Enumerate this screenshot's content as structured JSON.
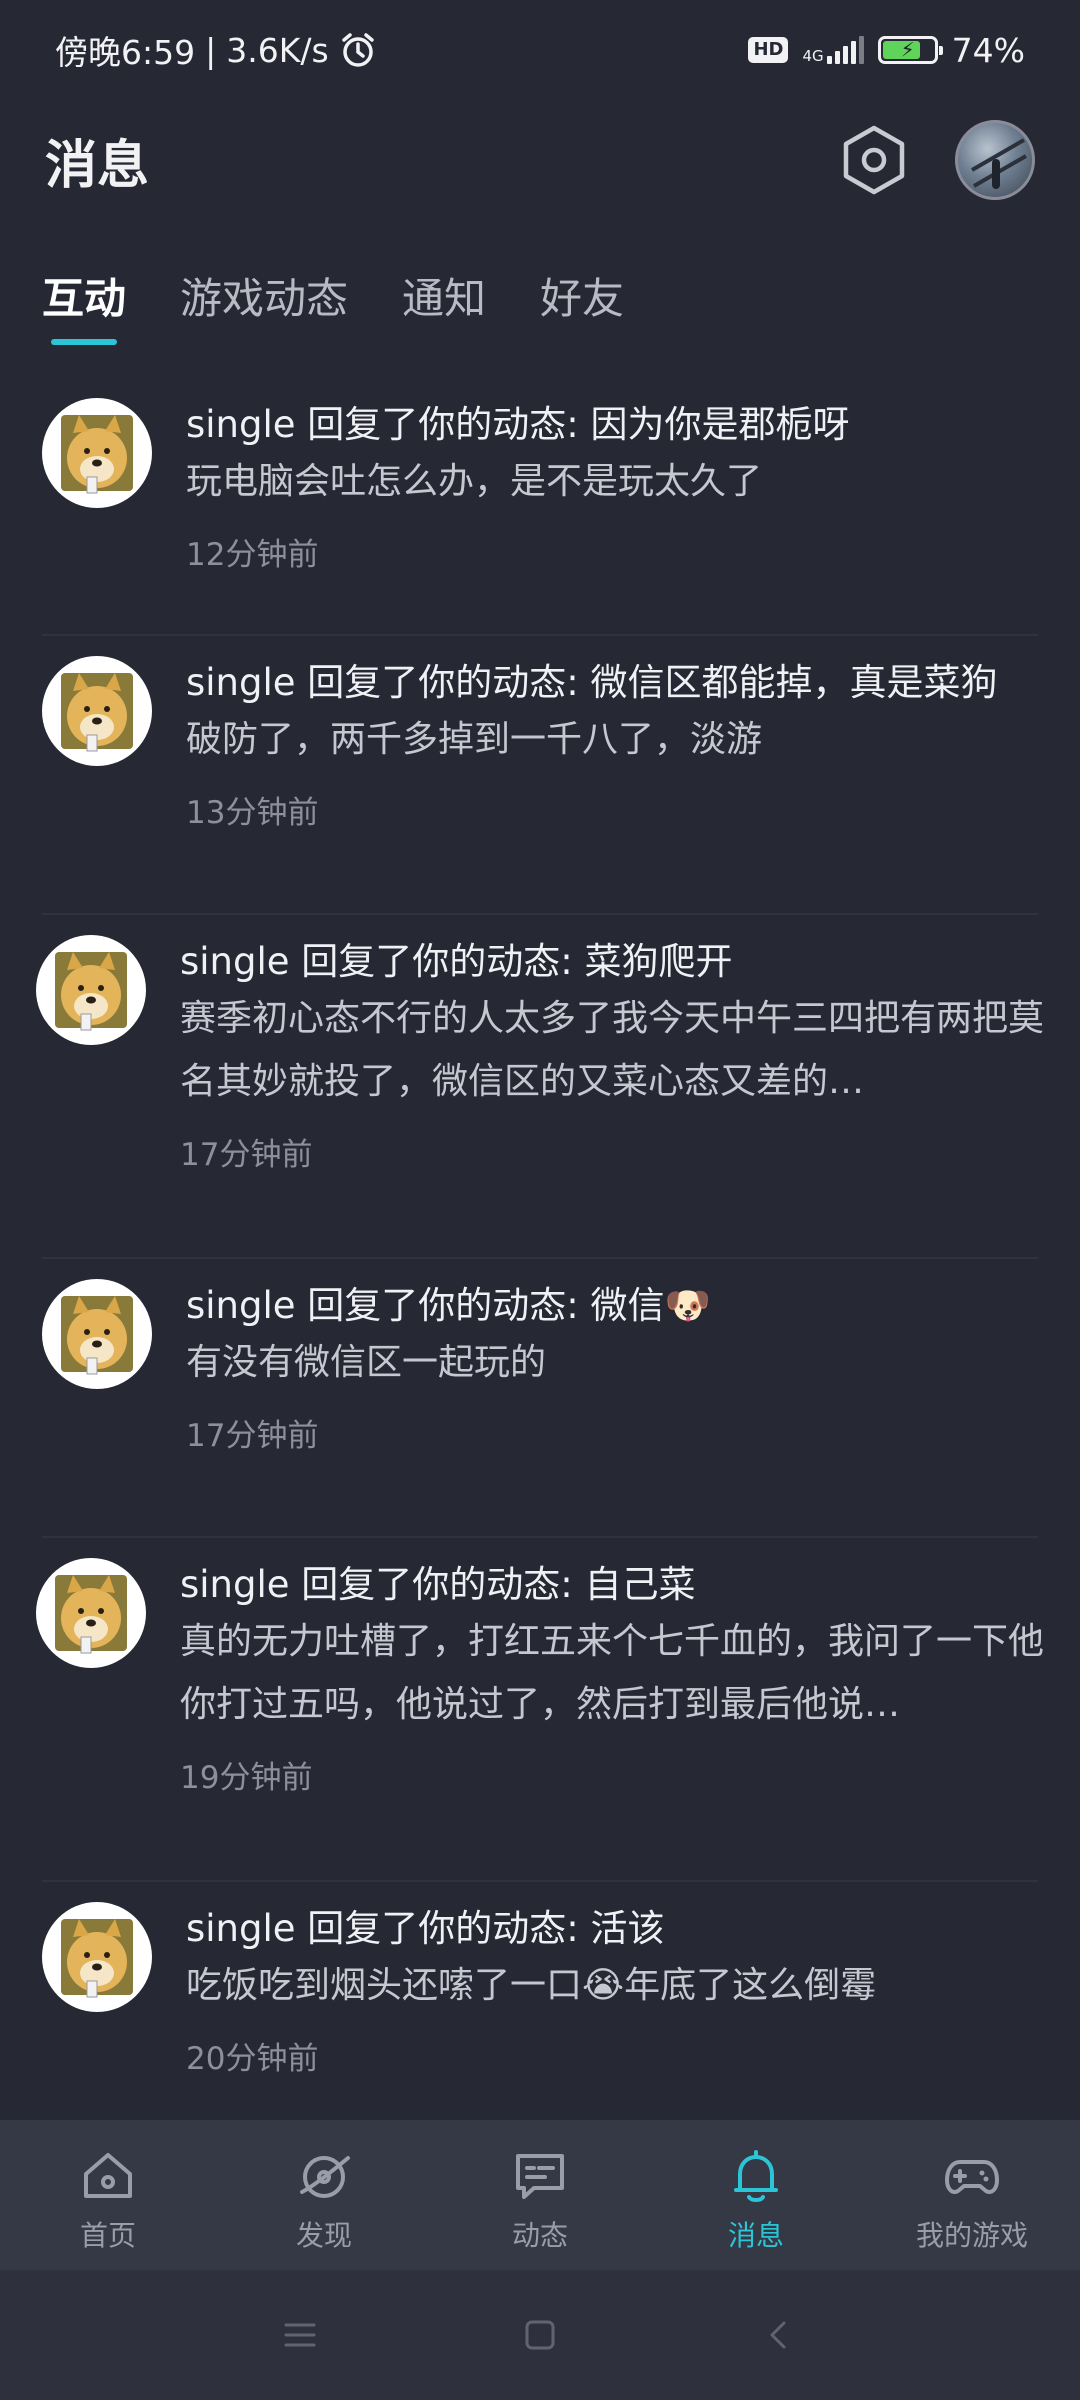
{
  "status_bar": {
    "time": "傍晚6:59",
    "separator": "|",
    "speed": "3.6K/s",
    "hd": "HD",
    "network": "4G",
    "battery": "74%",
    "battery_level": 0.74
  },
  "header": {
    "title": "消息"
  },
  "tabs": [
    {
      "label": "互动",
      "active": true
    },
    {
      "label": "游戏动态",
      "active": false
    },
    {
      "label": "通知",
      "active": false
    },
    {
      "label": "好友",
      "active": false
    }
  ],
  "messages": [
    {
      "title": "single 回复了你的动态: 因为你是郡栀呀",
      "content": "玩电脑会吐怎么办，是不是玩太久了",
      "time": "12分钟前"
    },
    {
      "title": "single 回复了你的动态: 微信区都能掉，真是菜狗",
      "content": "破防了，两千多掉到一千八了，淡游",
      "time": "13分钟前"
    },
    {
      "title": "single 回复了你的动态: 菜狗爬开",
      "content": "赛季初心态不行的人太多了我今天中午三四把有两把莫名其妙就投了，微信区的又菜心态又差的…",
      "time": "17分钟前"
    },
    {
      "title": "single 回复了你的动态: 微信🐶",
      "content": "有没有微信区一起玩的",
      "time": "17分钟前"
    },
    {
      "title": "single 回复了你的动态: 自己菜",
      "content": "真的无力吐槽了，打红五来个七千血的，我问了一下他你打过五吗，他说过了，然后打到最后他说…",
      "time": "19分钟前"
    },
    {
      "title": "single 回复了你的动态: 活该",
      "content": "吃饭吃到烟头还嗦了一口😭年底了这么倒霉",
      "time": "20分钟前"
    }
  ],
  "bottom_nav": [
    {
      "label": "首页",
      "icon": "home-icon"
    },
    {
      "label": "发现",
      "icon": "discover-icon"
    },
    {
      "label": "动态",
      "icon": "feed-icon"
    },
    {
      "label": "消息",
      "icon": "bell-icon",
      "active": true
    },
    {
      "label": "我的游戏",
      "icon": "gamepad-icon"
    }
  ],
  "colors": {
    "background": "#262834",
    "accent": "#2cc5d5",
    "nav_background": "#353845"
  }
}
